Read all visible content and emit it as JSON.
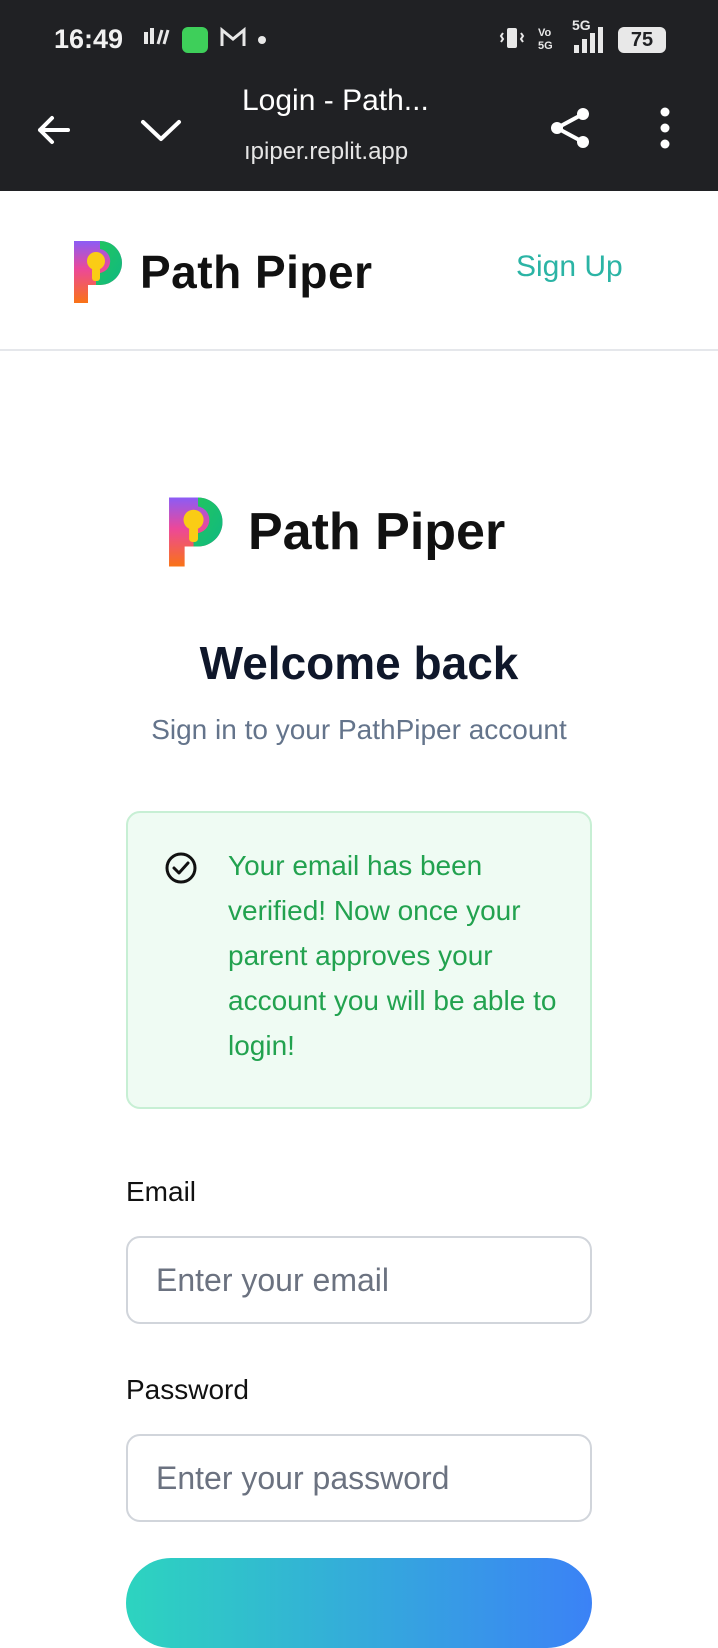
{
  "status_bar": {
    "time": "16:49",
    "left_icons": [
      "sim-signal-icon",
      "app-notification-icon",
      "gmail-icon",
      "dot-icon"
    ],
    "right_icons": [
      "vibrate-icon",
      "volte-icon",
      "5g-signal-icon"
    ],
    "network": "5G",
    "battery": "75"
  },
  "browser": {
    "title": "Login - Path...",
    "url": "ıpiper.replit.app"
  },
  "header": {
    "brand": "Path Piper",
    "signup_label": "Sign Up"
  },
  "main": {
    "brand": "Path Piper",
    "heading": "Welcome back",
    "subtitle": "Sign in to your PathPiper account",
    "alert": {
      "icon": "check-circle-icon",
      "message": "Your email has been verified! Now once your parent approves your account you will be able to login!"
    },
    "email_label": "Email",
    "email_placeholder": "Enter your email",
    "password_label": "Password",
    "password_placeholder": "Enter your password"
  },
  "colors": {
    "accent": "#2bb4a5",
    "success_text": "#22a24f",
    "success_bg": "#effbf3",
    "button_gradient_start": "#2dd4bf",
    "button_gradient_end": "#3b82f6"
  }
}
